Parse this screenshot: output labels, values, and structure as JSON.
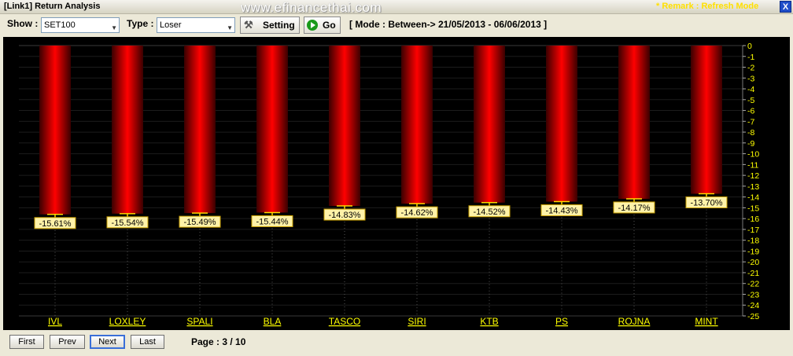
{
  "window": {
    "title": "[Link1] Return Analysis",
    "watermark": "www.efinancethai.com",
    "remark": "* Remark : Refresh Mode",
    "close_label": "X"
  },
  "toolbar": {
    "show_label": "Show :",
    "show_value": "SET100",
    "type_label": "Type :",
    "type_value": "Loser",
    "setting_label": "Setting",
    "go_label": "Go",
    "mode_text": "[ Mode : Between-> 21/05/2013 - 06/06/2013 ]"
  },
  "pagination": {
    "first": "First",
    "prev": "Prev",
    "next": "Next",
    "last": "Last",
    "page_text": "Page : 3 / 10"
  },
  "chart_data": {
    "type": "bar",
    "title": "",
    "xlabel": "",
    "ylabel": "",
    "categories": [
      "IVL",
      "LOXLEY",
      "SPALI",
      "BLA",
      "TASCO",
      "SIRI",
      "KTB",
      "PS",
      "ROJNA",
      "MINT"
    ],
    "values": [
      -15.61,
      -15.54,
      -15.49,
      -15.44,
      -14.83,
      -14.62,
      -14.52,
      -14.43,
      -14.17,
      -13.7
    ],
    "data_labels": [
      "-15.61%",
      "-15.54%",
      "-15.49%",
      "-15.44%",
      "-14.83%",
      "-14.62%",
      "-14.52%",
      "-14.43%",
      "-14.17%",
      "-13.70%"
    ],
    "ylim": [
      -25,
      0
    ],
    "ytick_step": 1,
    "yaxis_side": "right",
    "grid": true,
    "colors": {
      "background": "#000000",
      "bar_center": "#ff0000",
      "bar_edge": "#3a0000",
      "tick_text": "#ffff00",
      "label_bg": "#fff2a8",
      "grid": "#3a3a3a"
    }
  }
}
